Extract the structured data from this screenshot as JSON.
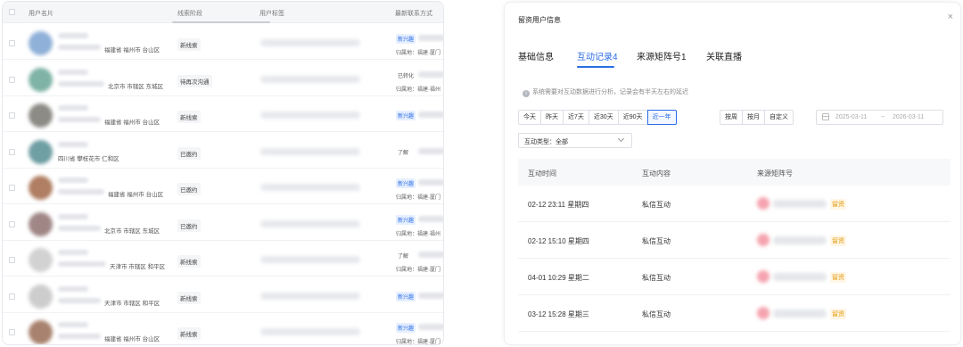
{
  "left_table": {
    "headers": [
      "用户名片",
      "线索阶段",
      "用户标签",
      "最新联系方式"
    ],
    "rows": [
      {
        "location": "福建省 福州市 台山区",
        "stage": "新线索",
        "contact_tag": "新兴趣",
        "contact_tag_style": "blue",
        "contact_label": "归属地：福建·厦门",
        "avatar_color": "#8fb0d8"
      },
      {
        "location": "北京市 市辖区 东城区",
        "stage": "待再次沟通",
        "contact_tag": "已转化",
        "contact_tag_style": "gray",
        "contact_label": "归属地：福建·福州",
        "avatar_color": "#7fb3a5"
      },
      {
        "location": "福建省 福州市 台山区",
        "stage": "新线索",
        "contact_tag": "新兴趣",
        "contact_tag_style": "blue",
        "contact_label": "",
        "avatar_color": "#8d8b86"
      },
      {
        "location": "四川省 攀枝花市 仁和区",
        "stage": "已邀约",
        "contact_tag": "了解",
        "contact_tag_style": "gray",
        "contact_label": "",
        "avatar_color": "#6f9ea3"
      },
      {
        "location": "福建省 福州市 台山区",
        "stage": "已邀约",
        "contact_tag": "新兴趣",
        "contact_tag_style": "blue",
        "contact_label": "归属地：福建·厦门",
        "avatar_color": "#b07e62"
      },
      {
        "location": "北京市 市辖区 东城区",
        "stage": "已邀约",
        "contact_tag": "新兴趣",
        "contact_tag_style": "blue",
        "contact_label": "归属地：福建·福州",
        "avatar_color": "#a08786"
      },
      {
        "location": "天津市 市辖区 和平区",
        "stage": "新线索",
        "contact_tag": "了解",
        "contact_tag_style": "gray",
        "contact_label": "归属地：福建·厦门",
        "avatar_color": "#d2d2d2"
      },
      {
        "location": "天津市 市辖区 和平区",
        "stage": "新线索",
        "contact_tag": "新兴趣",
        "contact_tag_style": "blue",
        "contact_label": "",
        "avatar_color": "#cdcdcd"
      },
      {
        "location": "福建省 福州市 台山区",
        "stage": "新线索",
        "contact_tag": "新兴趣",
        "contact_tag_style": "blue",
        "contact_label": "归属地：福建·厦门",
        "avatar_color": "#a8826e"
      }
    ]
  },
  "modal": {
    "title": "留资用户信息",
    "close_icon": "close-icon",
    "tabs": [
      {
        "label": "基础信息",
        "active": false
      },
      {
        "label": "互动记录4",
        "active": true
      },
      {
        "label": "来源矩阵号1",
        "active": false
      },
      {
        "label": "关联直播",
        "active": false
      }
    ],
    "notice": "系统需要对互动数据进行分析，记录会有半天左右的延迟",
    "notice_icon": "info-icon",
    "range_buttons": [
      {
        "label": "今天",
        "active": false
      },
      {
        "label": "昨天",
        "active": false
      },
      {
        "label": "近7天",
        "active": false
      },
      {
        "label": "近30天",
        "active": false
      },
      {
        "label": "近90天",
        "active": false
      },
      {
        "label": "近一年",
        "active": true
      }
    ],
    "period_buttons": [
      {
        "label": "按周",
        "active": false
      },
      {
        "label": "按月",
        "active": false
      },
      {
        "label": "自定义",
        "active": false
      }
    ],
    "date_start": "2025-03-11",
    "date_sep": "~",
    "date_end": "2026-03-11",
    "interaction_type": "互动类型：全部",
    "table": {
      "headers": [
        "互动时间",
        "互动内容",
        "来源矩阵号"
      ],
      "rows": [
        {
          "time": "02-12 23:11 星期四",
          "content": "私信互动",
          "badge": "留资"
        },
        {
          "time": "02-12 15:10 星期四",
          "content": "私信互动",
          "badge": "留资"
        },
        {
          "time": "04-01 10:29 星期二",
          "content": "私信互动",
          "badge": "留资"
        },
        {
          "time": "03-12 15:28 星期三",
          "content": "私信互动",
          "badge": "留资"
        }
      ]
    },
    "accent_color": "#2b6de5",
    "badge_color": "#e39a0c"
  }
}
